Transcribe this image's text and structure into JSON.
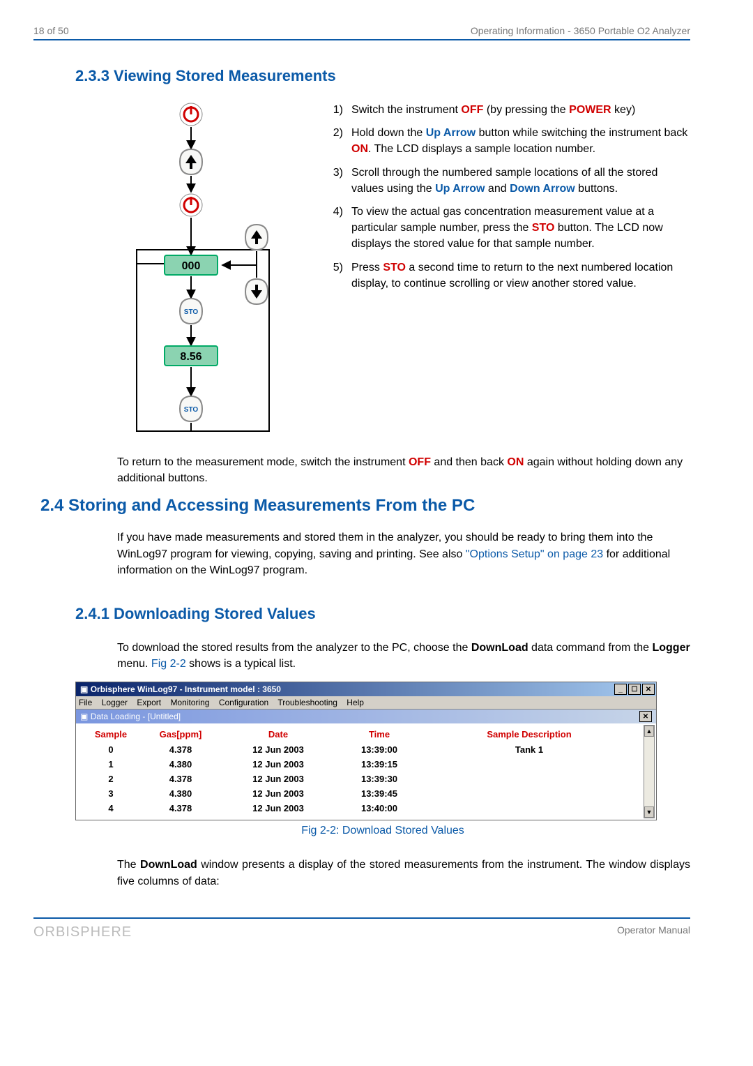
{
  "header": {
    "left": "18 of 50",
    "right": "Operating Information - 3650 Portable O2 Analyzer"
  },
  "footer": {
    "left": "ORBISPHERE",
    "right": "Operator Manual"
  },
  "section_233_title": "2.3.3 Viewing Stored Measurements",
  "section_24_title": "2.4  Storing and Accessing Measurements From the PC",
  "section_241_title": "2.4.1 Downloading Stored Values",
  "diagram": {
    "counter_label": "000",
    "value_label": "8.56",
    "sto_label": "STO"
  },
  "steps": [
    {
      "num": "1)",
      "plain": [
        "Switch the instrument ",
        " (by pressing the ",
        " key)"
      ],
      "em": [
        "OFF",
        "POWER"
      ]
    },
    {
      "num": "2)",
      "t": "Hold down the ",
      "b1": "Up Arrow",
      "t2": " button while switching the instrument back ",
      "r": "ON",
      "t3": ". The LCD displays a sample location number."
    },
    {
      "num": "3)",
      "t": "Scroll through the numbered sample locations of all the stored values using the ",
      "b1": "Up Arrow",
      "t2": " and ",
      "b2": "Down Arrow",
      "t3": " buttons."
    },
    {
      "num": "4)",
      "t": "To view the actual gas concentration measurement value at a particular sample number, press the ",
      "r": "STO",
      "t2": " button. The LCD now displays the stored value for that sample number."
    },
    {
      "num": "5)",
      "t": "Press ",
      "r": "STO",
      "t2": " a second time to return to the next numbered location display, to continue scrolling or view another stored value."
    }
  ],
  "return_para": {
    "p1": "To return to the measurement mode, switch the instrument ",
    "off": "OFF",
    "p2": " and then back ",
    "on": "ON",
    "p3": " again without holding down any additional buttons."
  },
  "pc_intro": {
    "t": "If you have made measurements and stored them in the analyzer, you should be ready to bring them into the WinLog97 program for viewing, copying, saving and printing. See also ",
    "link": "\"Options Setup\" on page 23",
    "t2": " for additional information on the WinLog97 program."
  },
  "download_para": {
    "t1": "To download the stored results from the analyzer to the PC, choose the ",
    "b": "DownLoad",
    "t2": " data command from the ",
    "b2": "Logger",
    "t3": " menu. ",
    "link": "Fig 2-2",
    "t4": " shows is a typical list."
  },
  "app": {
    "title": "Orbisphere WinLog97 - Instrument model : 3650",
    "menu": [
      "File",
      "Logger",
      "Export",
      "Monitoring",
      "Configuration",
      "Troubleshooting",
      "Help"
    ],
    "childTitle": "Data Loading - [Untitled]",
    "columns": [
      "Sample",
      "Gas[ppm]",
      "Date",
      "Time",
      "Sample Description"
    ],
    "rows": [
      {
        "sample": "0",
        "gas": "4.378",
        "date": "12 Jun 2003",
        "time": "13:39:00",
        "desc": "Tank 1"
      },
      {
        "sample": "1",
        "gas": "4.380",
        "date": "12 Jun 2003",
        "time": "13:39:15",
        "desc": ""
      },
      {
        "sample": "2",
        "gas": "4.378",
        "date": "12 Jun 2003",
        "time": "13:39:30",
        "desc": ""
      },
      {
        "sample": "3",
        "gas": "4.380",
        "date": "12 Jun 2003",
        "time": "13:39:45",
        "desc": ""
      },
      {
        "sample": "4",
        "gas": "4.378",
        "date": "12 Jun 2003",
        "time": "13:40:00",
        "desc": ""
      }
    ]
  },
  "fig_caption": "Fig 2-2: Download Stored Values",
  "outro": {
    "t1": "The ",
    "b": "DownLoad",
    "t2": " window presents a display of the stored measurements from the instrument. The window displays five columns of data:"
  },
  "chart_data": {
    "type": "table",
    "title": "Download Stored Values",
    "columns": [
      "Sample",
      "Gas[ppm]",
      "Date",
      "Time",
      "Sample Description"
    ],
    "rows": [
      [
        0,
        4.378,
        "12 Jun 2003",
        "13:39:00",
        "Tank 1"
      ],
      [
        1,
        4.38,
        "12 Jun 2003",
        "13:39:15",
        ""
      ],
      [
        2,
        4.378,
        "12 Jun 2003",
        "13:39:30",
        ""
      ],
      [
        3,
        4.38,
        "12 Jun 2003",
        "13:39:45",
        ""
      ],
      [
        4,
        4.378,
        "12 Jun 2003",
        "13:40:00",
        ""
      ]
    ]
  }
}
